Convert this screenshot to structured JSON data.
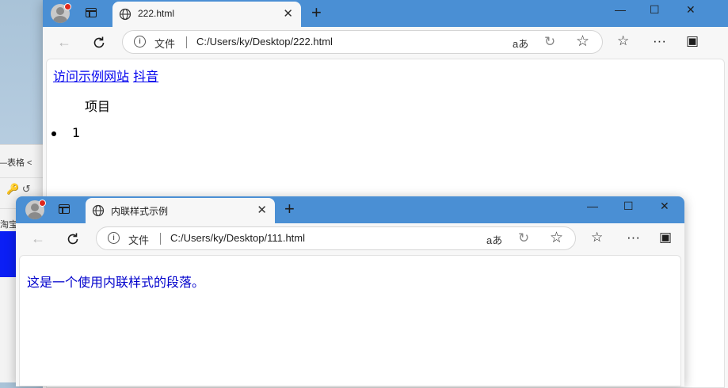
{
  "background_window": {
    "title": "—表格 <",
    "toolbar_text": "🔑 ↺",
    "side_text": "淘宝"
  },
  "window1": {
    "tab_title": "222.html",
    "address": {
      "file_label": "文件",
      "url": "C:/Users/ky/Desktop/222.html"
    },
    "content": {
      "links": [
        "访问示例网站",
        "抖音"
      ],
      "table_header": "项目",
      "list_items": [
        "1"
      ]
    }
  },
  "window2": {
    "tab_title": "内联样式示例",
    "address": {
      "file_label": "文件",
      "url": "C:/Users/ky/Desktop/111.html"
    },
    "content": {
      "paragraph": "这是一个使用内联样式的段落。"
    }
  },
  "icons": {
    "read_aloud": "aあ",
    "new_tab": "+",
    "close": "✕",
    "minimize": "—",
    "maximize": "☐"
  },
  "colors": {
    "titlebar": "#4a8fd4",
    "paragraph_text": "#0000cc",
    "link": "#0000ee"
  }
}
